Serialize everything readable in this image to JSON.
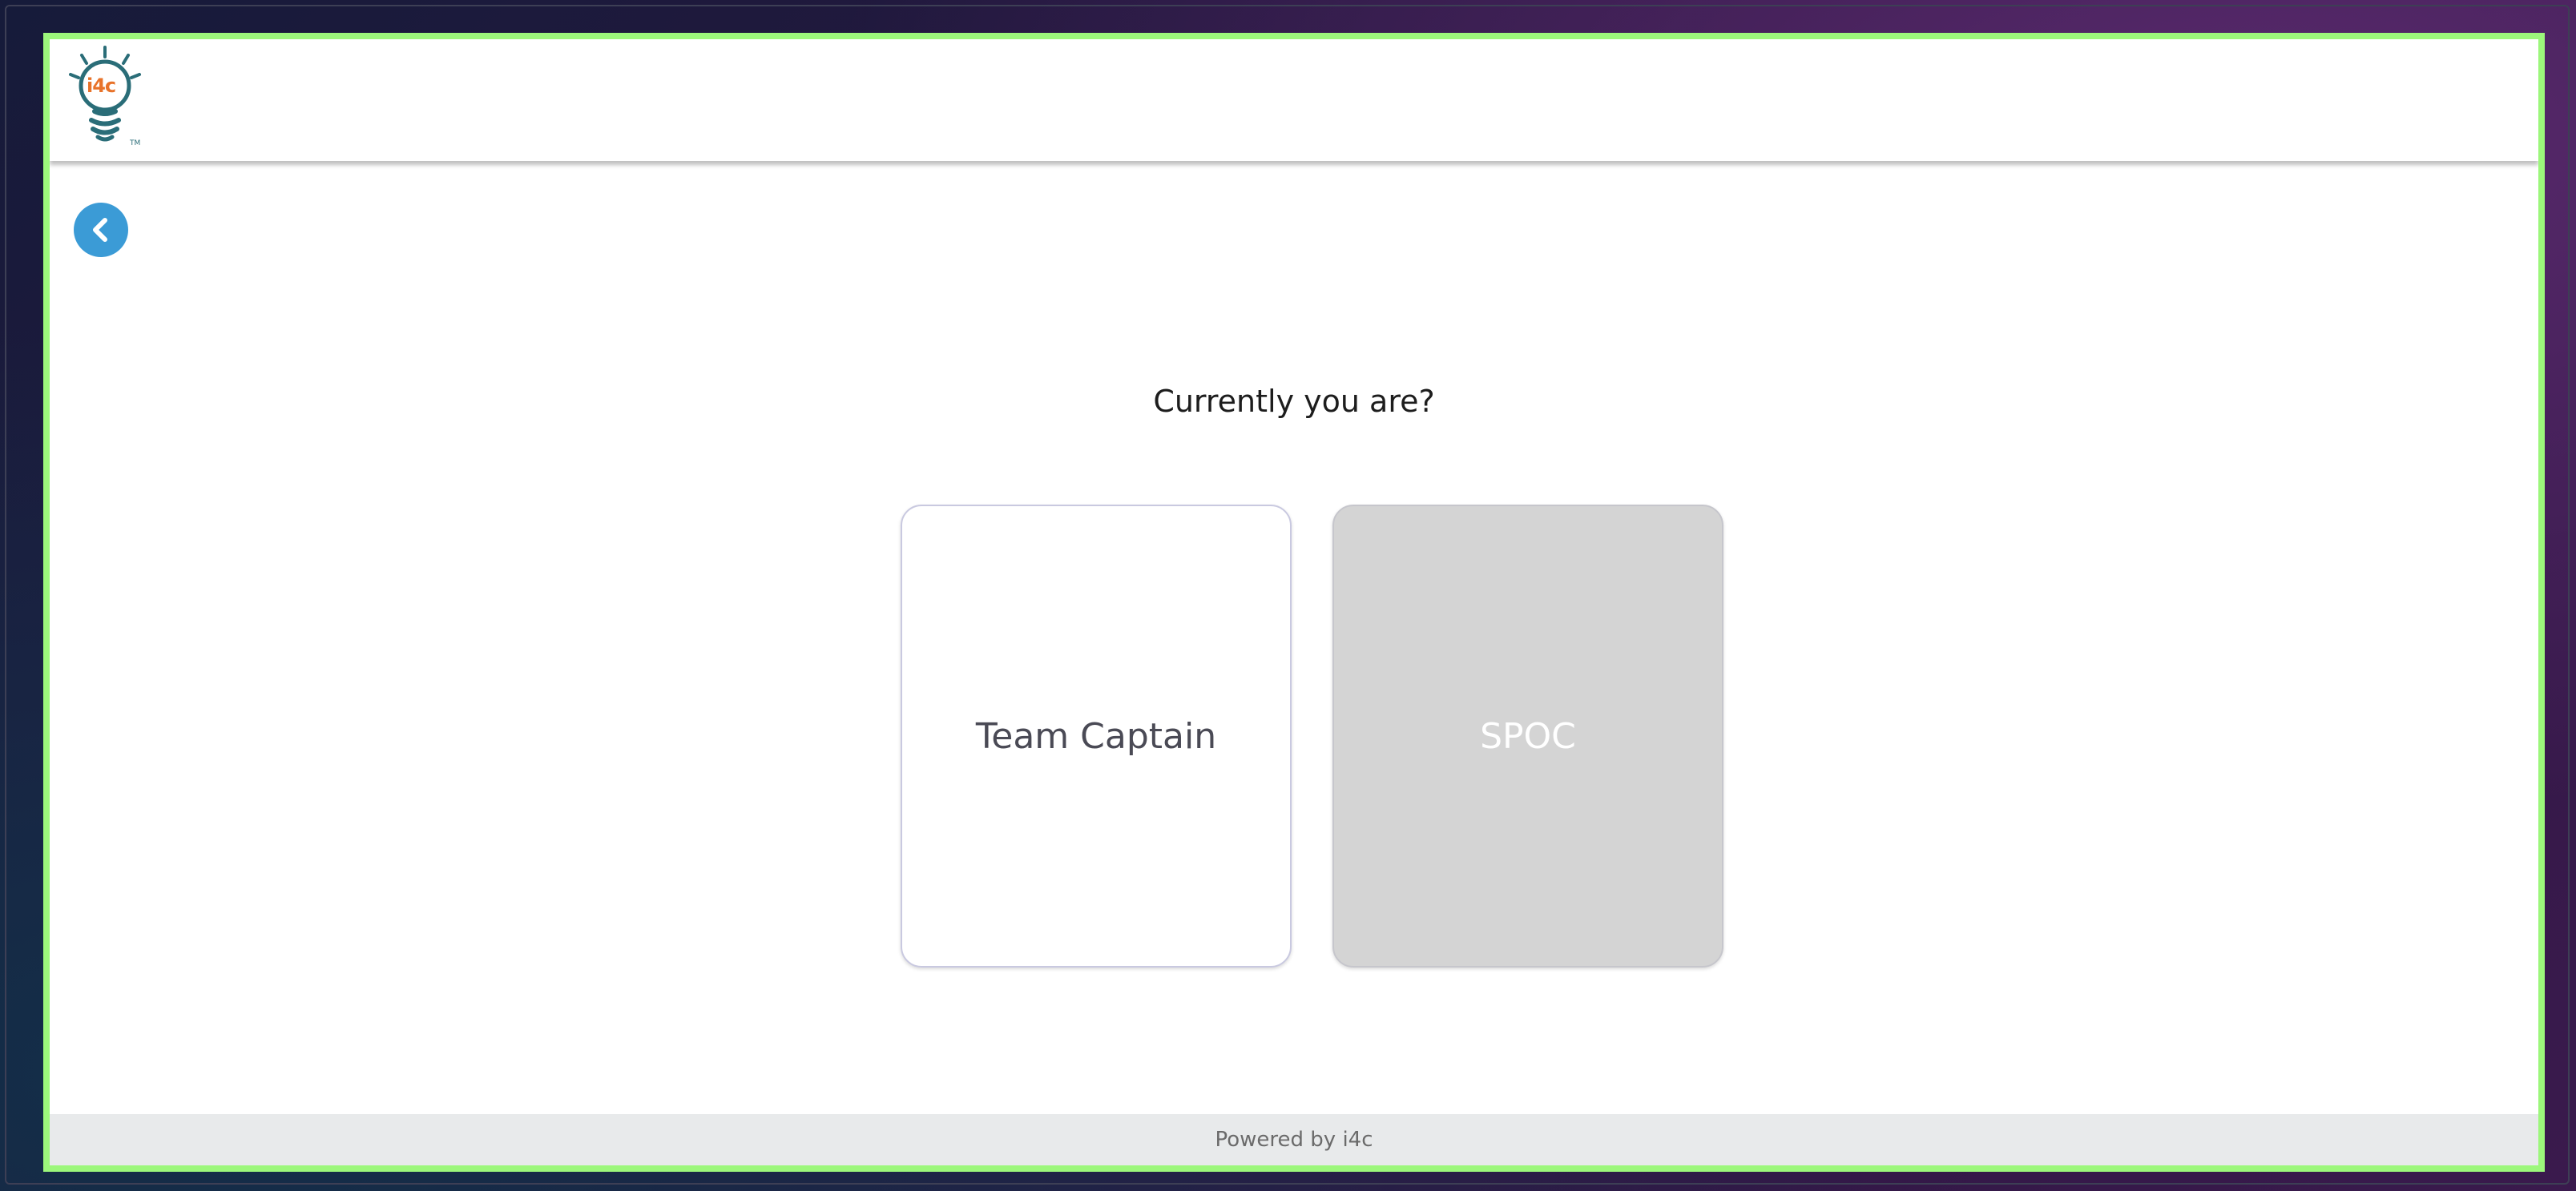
{
  "header": {
    "logo_text": "i4c",
    "logo_tm": "TM"
  },
  "main": {
    "question": "Currently you are?",
    "roles": [
      {
        "label": "Team Captain",
        "state": "selectable"
      },
      {
        "label": "SPOC",
        "state": "disabled"
      }
    ]
  },
  "footer": {
    "text": "Powered by i4c"
  },
  "colors": {
    "frame_border": "#9cf77b",
    "back_button": "#3b9bd6",
    "spoc_card": "#d4d4d4",
    "footer_bg": "#e8eaeb"
  },
  "icons": {
    "logo": "lightbulb-logo-icon",
    "back": "chevron-left-icon"
  }
}
